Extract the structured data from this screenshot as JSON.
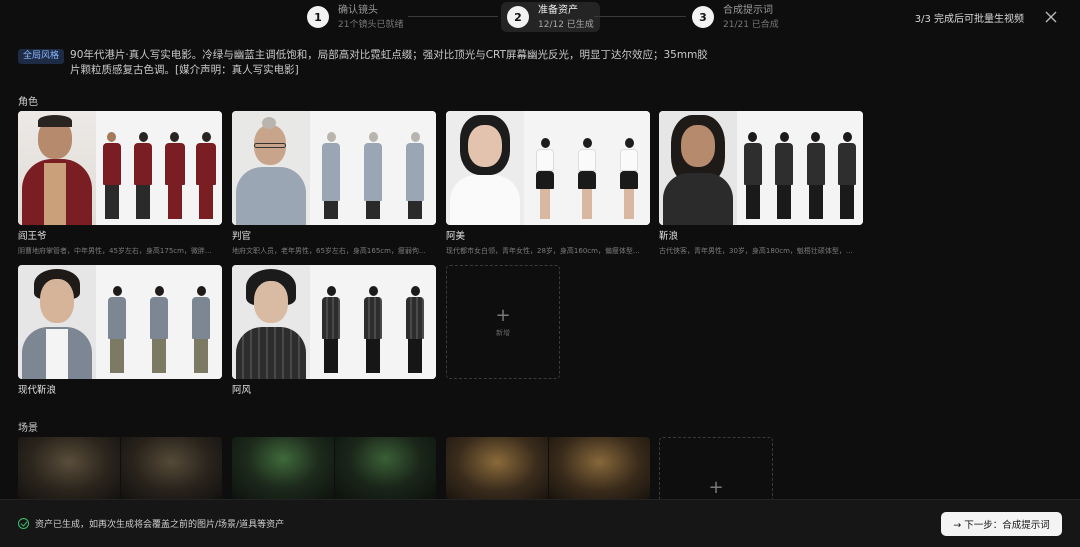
{
  "steps": [
    {
      "num": "1",
      "title": "确认镜头",
      "sub": "21个镜头已就绪"
    },
    {
      "num": "2",
      "title": "准备资产",
      "sub": "12/12 已生成"
    },
    {
      "num": "3",
      "title": "合成提示词",
      "sub": "21/21 已合成"
    }
  ],
  "header": {
    "right_text": "3/3 完成后可批量生视频",
    "close_icon": "close-icon"
  },
  "style": {
    "tag": "全局风格",
    "text": "90年代港片·真人写实电影。冷绿与幽蓝主调低饱和，局部高对比霓虹点缀；强对比顶光与CRT屏幕幽光反光，明显丁达尔效应；35mm胶片颗粒质感复古色调。[媒介声明：真人写实电影]"
  },
  "sections": {
    "characters": "角色",
    "scenes": "场景"
  },
  "characters": [
    {
      "name": "阎王爷",
      "desc": "阴曹地府掌管者，中年男性，45岁左右，身高175cm，微胖..."
    },
    {
      "name": "判官",
      "desc": "地府文职人员，老年男性，65岁左右，身高165cm，瘦弱佝..."
    },
    {
      "name": "阿美",
      "desc": "现代都市女白领，青年女性，28岁，身高160cm，偏瘦体型..."
    },
    {
      "name": "靳浪",
      "desc": "古代侠客，青年男性，30岁，身高180cm，魁梧壮硕体型，..."
    },
    {
      "name": "现代靳浪",
      "desc": ""
    },
    {
      "name": "阿风",
      "desc": ""
    }
  ],
  "add_label": "新增",
  "footer": {
    "message": "资产已生成，如再次生成将会覆盖之前的图片/场景/道具等资产",
    "next_button": "→ 下一步：合成提示词"
  },
  "colors": {
    "accent_tag_bg": "#1d2b45",
    "accent_tag_text": "#8fb7ff",
    "success": "#3fbf6a",
    "background": "#0e0e0f"
  }
}
